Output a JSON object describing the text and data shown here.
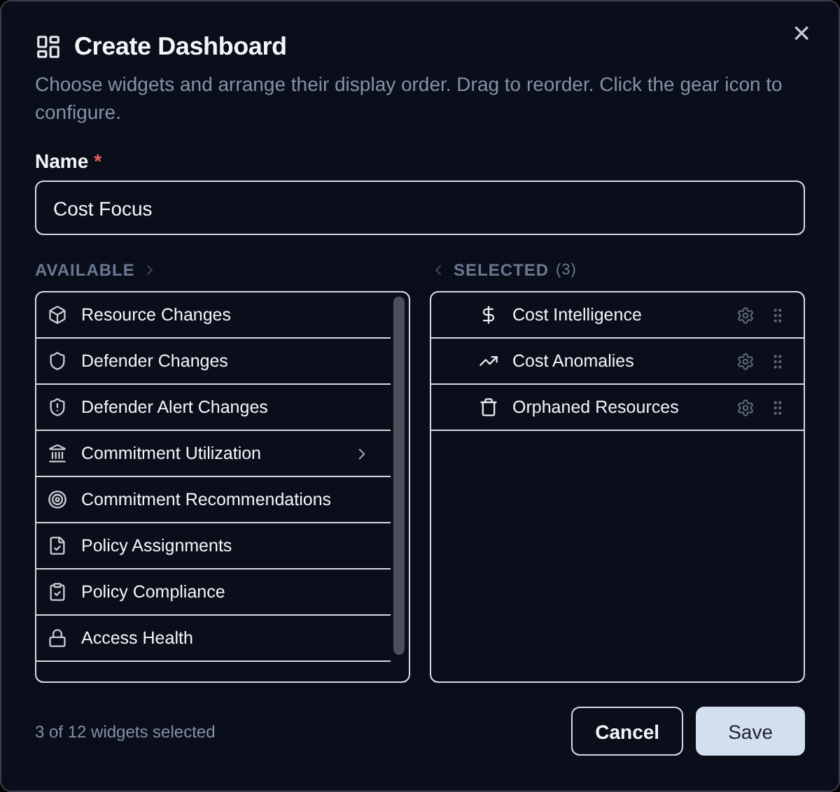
{
  "dialog": {
    "title": "Create Dashboard",
    "description": "Choose widgets and arrange their display order. Drag to reorder. Click the gear icon to configure.",
    "close_label": "×"
  },
  "name_field": {
    "label": "Name",
    "required_mark": "*",
    "value": "Cost Focus"
  },
  "available": {
    "heading": "AVAILABLE",
    "items": [
      {
        "label": "Resource Changes",
        "has_submenu": false
      },
      {
        "label": "Defender Changes",
        "has_submenu": false
      },
      {
        "label": "Defender Alert Changes",
        "has_submenu": false
      },
      {
        "label": "Commitment Utilization",
        "has_submenu": true
      },
      {
        "label": "Commitment Recommendations",
        "has_submenu": false
      },
      {
        "label": "Policy Assignments",
        "has_submenu": false
      },
      {
        "label": "Policy Compliance",
        "has_submenu": false
      },
      {
        "label": "Access Health",
        "has_submenu": false
      }
    ]
  },
  "selected": {
    "heading": "SELECTED",
    "count": "(3)",
    "items": [
      {
        "label": "Cost Intelligence"
      },
      {
        "label": "Cost Anomalies"
      },
      {
        "label": "Orphaned Resources"
      }
    ]
  },
  "footer": {
    "status": "3 of 12 widgets selected",
    "buttons": [
      {
        "label": "Cancel",
        "kind": "secondary"
      },
      {
        "label": "Save",
        "kind": "primary"
      }
    ]
  }
}
